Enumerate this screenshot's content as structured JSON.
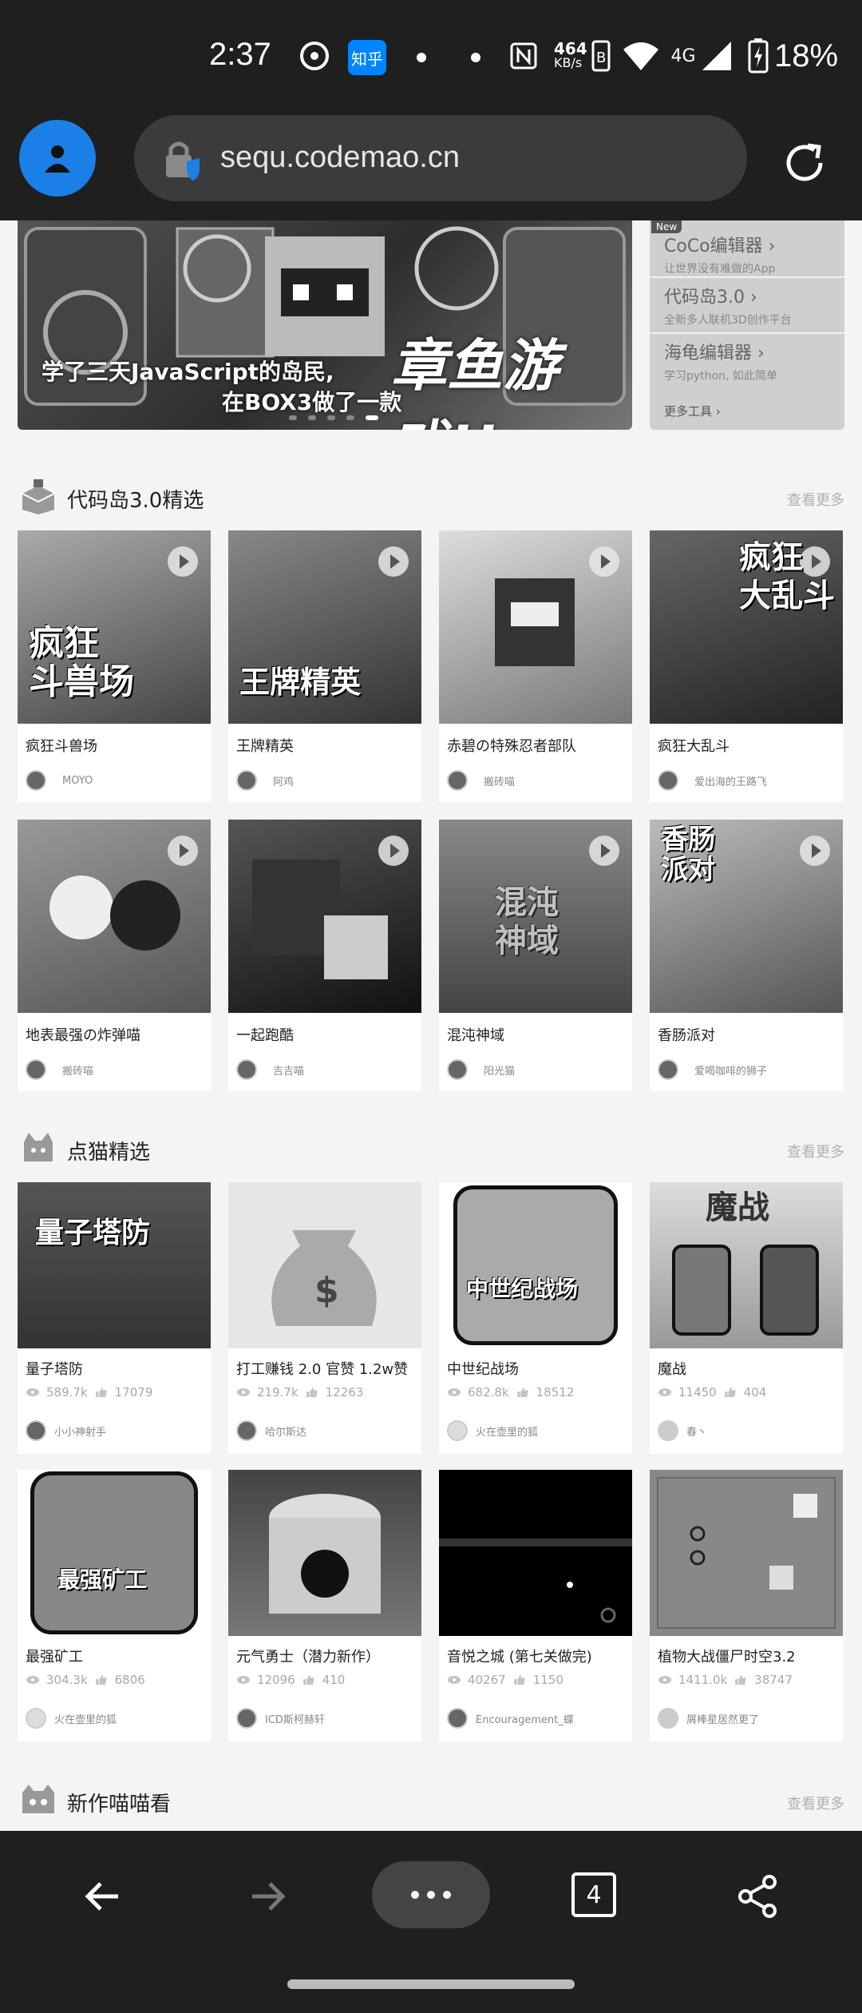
{
  "status_bar": {
    "time": "2:37",
    "zhihu_label": "知乎",
    "speed_value": "464",
    "speed_unit": "KB/s",
    "network": "4G",
    "battery": "18%"
  },
  "address_bar": {
    "url": "sequ.codemao.cn"
  },
  "banner": {
    "line1": "学了三天JavaScript的岛民,",
    "line2": "在BOX3做了一款",
    "big_text": "章鱼游戏!!"
  },
  "side_tools": {
    "new_badge": "New",
    "items": [
      {
        "title": "CoCo编辑器 ›",
        "sub": "让世界没有难做的App"
      },
      {
        "title": "代码岛3.0 ›",
        "sub": "全新多人联机3D创作平台"
      },
      {
        "title": "海龟编辑器 ›",
        "sub": "学习python, 如此简单"
      }
    ],
    "more": "更多工具 ›"
  },
  "sections": [
    {
      "title": "代码岛3.0精选",
      "more": "查看更多"
    },
    {
      "title": "点猫精选",
      "more": "查看更多"
    },
    {
      "title": "新作喵喵看",
      "more": "查看更多"
    }
  ],
  "island_cards": [
    {
      "title": "疯狂斗兽场",
      "author": "MOYO",
      "thumb_text": "疯狂\n斗兽场"
    },
    {
      "title": "王牌精英",
      "author": "阿鸡",
      "thumb_text": "王牌精英"
    },
    {
      "title": "赤碧の特殊忍者部队",
      "author": "搬砖喵",
      "thumb_text": ""
    },
    {
      "title": "疯狂大乱斗",
      "author": "爱出海的王路飞",
      "thumb_text": "疯狂\n大乱斗"
    },
    {
      "title": "地表最强の炸弹喵",
      "author": "搬砖喵",
      "thumb_text": ""
    },
    {
      "title": "一起跑酷",
      "author": "吉吉喵",
      "thumb_text": ""
    },
    {
      "title": "混沌神域",
      "author": "阳光猫",
      "thumb_text": "混沌\n神域"
    },
    {
      "title": "香肠派对",
      "author": "爱喝咖啡的狮子",
      "thumb_text": "香肠\n派对"
    }
  ],
  "cat_cards": [
    {
      "title": "量子塔防",
      "views": "589.7k",
      "likes": "17079",
      "author": "小小神射手",
      "thumb_text": "量子塔防"
    },
    {
      "title": "打工赚钱 2.0 官赞 1.2w赞",
      "views": "219.7k",
      "likes": "12263",
      "author": "哈尔斯达",
      "thumb_text": "$"
    },
    {
      "title": "中世纪战场",
      "views": "682.8k",
      "likes": "18512",
      "author": "火在壶里的狐",
      "thumb_text": "中世纪战场"
    },
    {
      "title": "魔战",
      "views": "11450",
      "likes": "404",
      "author": "春丶",
      "thumb_text": "魔战"
    },
    {
      "title": "最强矿工",
      "views": "304.3k",
      "likes": "6806",
      "author": "火在壶里的狐",
      "thumb_text": "最强矿工"
    },
    {
      "title": "元气勇士（潜力新作）",
      "views": "12096",
      "likes": "410",
      "author": "ICD斯柯赫轩",
      "thumb_text": ""
    },
    {
      "title": "音悦之城 (第七关做完)",
      "views": "40267",
      "likes": "1150",
      "author": "Encouragement_蝶",
      "thumb_text": ""
    },
    {
      "title": "植物大战僵尸时空3.2",
      "views": "1411.0k",
      "likes": "38747",
      "author": "屑棒星居然更了",
      "thumb_text": ""
    }
  ],
  "bottom_bar": {
    "tab_count": "4"
  }
}
